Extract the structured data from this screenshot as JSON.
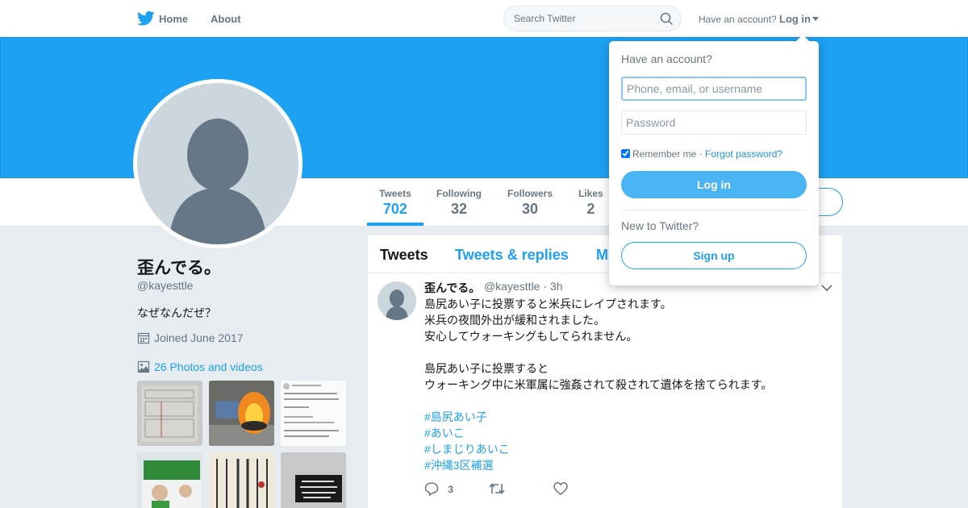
{
  "colors": {
    "brand": "#1da1f2",
    "login_button": "#4ab3f4",
    "link": "#1b95e0",
    "text_secondary": "#657786"
  },
  "nav": {
    "home_label": "Home",
    "about_label": "About",
    "search_placeholder": "Search Twitter",
    "have_account": "Have an account?",
    "login_label": "Log in",
    "icons": [
      "twitter-bird-icon",
      "home-icon",
      "search-icon",
      "caret-down-icon"
    ]
  },
  "profile": {
    "name": "歪んでる。",
    "handle": "@kayesttle",
    "bio": "なぜなんだぜ？",
    "joined": "Joined June 2017",
    "photos_link": "26 Photos and videos"
  },
  "stats": [
    {
      "label": "Tweets",
      "value": "702"
    },
    {
      "label": "Following",
      "value": "32"
    },
    {
      "label": "Followers",
      "value": "30"
    },
    {
      "label": "Likes",
      "value": "2"
    }
  ],
  "timeline": {
    "tabs": [
      "Tweets",
      "Tweets & replies",
      "M"
    ],
    "tweet": {
      "name": "歪んでる。",
      "handle": "@kayesttle",
      "time": "· 3h",
      "lines": [
        "島尻あい子に投票すると米兵にレイプされます。",
        "米兵の夜間外出が緩和されました。",
        "安心してウォーキングもしてられません。",
        "",
        "島尻あい子に投票すると",
        "ウォーキング中に米軍属に強姦されて殺されて遺体を捨てられます。",
        ""
      ],
      "hashtags": [
        "#島尻あい子",
        "#あいこ",
        "#しまじりあいこ",
        "#沖縄3区補選"
      ],
      "reply_count": "3"
    }
  },
  "login_dropdown": {
    "title": "Have an account?",
    "username_placeholder": "Phone, email, or username",
    "password_placeholder": "Password",
    "remember_label": "Remember me",
    "separator": "·",
    "forgot_label": "Forgot password?",
    "login_button": "Log in",
    "new_label": "New to Twitter?",
    "signup_button": "Sign up"
  }
}
